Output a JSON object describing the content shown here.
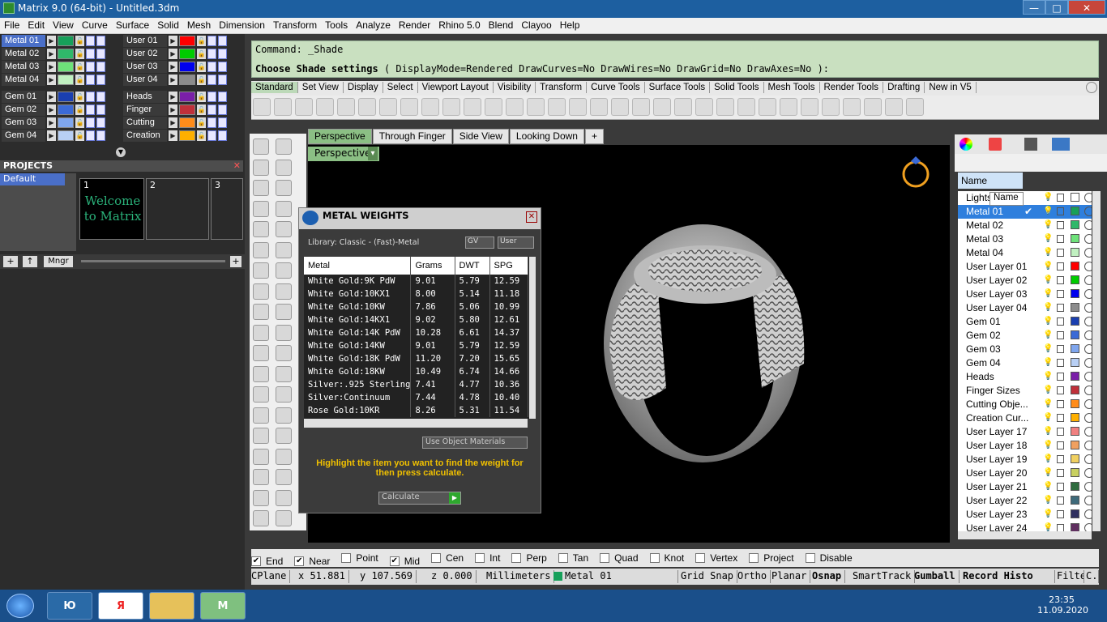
{
  "window": {
    "title": "Matrix 9.0 (64-bit) - Untitled.3dm",
    "min": "—",
    "max": "□",
    "close": "✕"
  },
  "menu": [
    "File",
    "Edit",
    "View",
    "Curve",
    "Surface",
    "Solid",
    "Mesh",
    "Dimension",
    "Transform",
    "Tools",
    "Analyze",
    "Render",
    "Rhino 5.0",
    "Blend",
    "Clayoo",
    "Help"
  ],
  "layer_grid": {
    "col1": [
      {
        "name": "Metal 01",
        "color": "#17a05a"
      },
      {
        "name": "Metal 02",
        "color": "#2fb86a"
      },
      {
        "name": "Metal 03",
        "color": "#6ee27a"
      },
      {
        "name": "Metal 04",
        "color": "#c0f0c0"
      }
    ],
    "col2": [
      {
        "name": "User 01",
        "color": "#ff0000"
      },
      {
        "name": "User 02",
        "color": "#00cc00"
      },
      {
        "name": "User 03",
        "color": "#0000ee"
      },
      {
        "name": "User 04",
        "color": "#8c8c8c"
      }
    ],
    "col1b": [
      {
        "name": "Gem 01",
        "color": "#1a3fb0"
      },
      {
        "name": "Gem 02",
        "color": "#3b6ad6"
      },
      {
        "name": "Gem 03",
        "color": "#7fa6ee"
      },
      {
        "name": "Gem 04",
        "color": "#b8cff4"
      }
    ],
    "col2b": [
      {
        "name": "Heads",
        "color": "#7a1fa8"
      },
      {
        "name": "Finger",
        "color": "#c0303a"
      },
      {
        "name": "Cutting",
        "color": "#ff8c1a"
      },
      {
        "name": "Creation",
        "color": "#ffb000"
      }
    ]
  },
  "projects": {
    "title": "PROJECTS",
    "items": [
      "Default"
    ],
    "thumbs": [
      "1",
      "2",
      "3"
    ],
    "welcome": "Welcome to Matrix",
    "mngr": "Mngr"
  },
  "command": {
    "line1": "Command: _Shade",
    "line2_prefix": "Choose Shade settings",
    "line2_opts": "( DisplayMode=Rendered  DrawCurves=No  DrawWires=No  DrawGrid=No  DrawAxes=No ):"
  },
  "toolbar_tabs": [
    "Standard",
    "Set View",
    "Display",
    "Select",
    "Viewport Layout",
    "Visibility",
    "Transform",
    "Curve Tools",
    "Surface Tools",
    "Solid Tools",
    "Mesh Tools",
    "Render Tools",
    "Drafting",
    "New in V5"
  ],
  "viewport_tabs": [
    "Perspective",
    "Through Finger",
    "Side View",
    "Looking Down",
    "+"
  ],
  "viewport_label": "Perspective",
  "metal_weights": {
    "title": "METAL WEIGHTS",
    "library": "Library: Classic - (Fast)-Metal",
    "gv": "GV",
    "user": "User",
    "headers": [
      "Metal",
      "Grams",
      "DWT",
      "SPG"
    ],
    "rows": [
      [
        "White Gold:9K PdW",
        "9.01",
        "5.79",
        "12.59"
      ],
      [
        "White Gold:10KX1",
        "8.00",
        "5.14",
        "11.18"
      ],
      [
        "White Gold:10KW",
        "7.86",
        "5.06",
        "10.99"
      ],
      [
        "White Gold:14KX1",
        "9.02",
        "5.80",
        "12.61"
      ],
      [
        "White Gold:14K PdW",
        "10.28",
        "6.61",
        "14.37"
      ],
      [
        "White Gold:14KW",
        "9.01",
        "5.79",
        "12.59"
      ],
      [
        "White Gold:18K PdW",
        "11.20",
        "7.20",
        "15.65"
      ],
      [
        "White Gold:18KW",
        "10.49",
        "6.74",
        "14.66"
      ],
      [
        "Silver:.925 Sterling",
        "7.41",
        "4.77",
        "10.36"
      ],
      [
        "Silver:Continuum",
        "7.44",
        "4.78",
        "10.40"
      ],
      [
        "Rose Gold:10KR",
        "8.26",
        "5.31",
        "11.54"
      ]
    ],
    "use_materials": "Use Object Materials",
    "instructions": "Highlight the item you want to find the weight for then press calculate.",
    "calculate": "Calculate"
  },
  "layers_panel": {
    "header": "Name",
    "tooltip": "Name",
    "rows": [
      {
        "name": "Lights",
        "color": "#ffffff"
      },
      {
        "name": "Metal 01",
        "color": "#17a05a",
        "selected": true,
        "check": "✔"
      },
      {
        "name": "Metal 02",
        "color": "#2fb86a"
      },
      {
        "name": "Metal 03",
        "color": "#6ee27a"
      },
      {
        "name": "Metal 04",
        "color": "#c0f0c0"
      },
      {
        "name": "User Layer 01",
        "color": "#ff0000"
      },
      {
        "name": "User Layer 02",
        "color": "#00cc00"
      },
      {
        "name": "User Layer 03",
        "color": "#0000ee"
      },
      {
        "name": "User Layer 04",
        "color": "#8c8c8c"
      },
      {
        "name": "Gem 01",
        "color": "#1a3fb0"
      },
      {
        "name": "Gem 02",
        "color": "#3b6ad6"
      },
      {
        "name": "Gem 03",
        "color": "#7fa6ee"
      },
      {
        "name": "Gem 04",
        "color": "#b8cff4"
      },
      {
        "name": "Heads",
        "color": "#7a1fa8"
      },
      {
        "name": "Finger Sizes",
        "color": "#c0303a"
      },
      {
        "name": "Cutting Obje...",
        "color": "#ff8c1a"
      },
      {
        "name": "Creation Cur...",
        "color": "#ffb000"
      },
      {
        "name": "User Layer 17",
        "color": "#f08080"
      },
      {
        "name": "User Layer 18",
        "color": "#f0a060"
      },
      {
        "name": "User Layer 19",
        "color": "#f0d060"
      },
      {
        "name": "User Layer 20",
        "color": "#c8d060"
      },
      {
        "name": "User Layer 21",
        "color": "#2e6b3e"
      },
      {
        "name": "User Layer 22",
        "color": "#3e6a7a"
      },
      {
        "name": "User Layer 23",
        "color": "#303060"
      },
      {
        "name": "User Layer 24",
        "color": "#603060"
      }
    ]
  },
  "osnap": [
    {
      "label": "End",
      "checked": true
    },
    {
      "label": "Near",
      "checked": true
    },
    {
      "label": "Point",
      "checked": false
    },
    {
      "label": "Mid",
      "checked": true
    },
    {
      "label": "Cen",
      "checked": false
    },
    {
      "label": "Int",
      "checked": false
    },
    {
      "label": "Perp",
      "checked": false
    },
    {
      "label": "Tan",
      "checked": false
    },
    {
      "label": "Quad",
      "checked": false
    },
    {
      "label": "Knot",
      "checked": false
    },
    {
      "label": "Vertex",
      "checked": false
    },
    {
      "label": "Project",
      "checked": false
    },
    {
      "label": "Disable",
      "checked": false
    }
  ],
  "status": {
    "cplane": "CPlane",
    "x": "x 51.881",
    "y": "y 107.569",
    "z": "z 0.000",
    "units": "Millimeters",
    "layer": "Metal 01",
    "grid": "Grid Snap",
    "ortho": "Ortho",
    "planar": "Planar",
    "osnap": "Osnap",
    "smart": "SmartTrack",
    "gumball": "Gumball",
    "record": "Record Histo",
    "filter": "Filte",
    "c": "C.."
  },
  "taskbar": {
    "time": "23:35",
    "date": "11.09.2020"
  },
  "colors": {
    "accent": "#8bbf84",
    "command_bg": "#c9e0c0",
    "selection": "#2f7fdd"
  }
}
